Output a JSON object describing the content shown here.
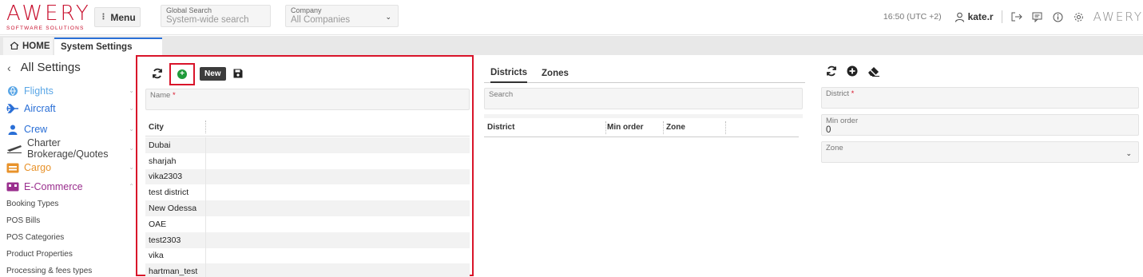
{
  "brand": {
    "name": "AWERY",
    "sub": "SOFTWARE SOLUTIONS",
    "color": "#c8102e"
  },
  "header": {
    "menu_label": "Menu",
    "global_search": {
      "label": "Global Search",
      "placeholder": "System-wide search"
    },
    "company": {
      "label": "Company",
      "value": "All Companies"
    },
    "time": "16:50 (UTC +2)",
    "user": "kate.r",
    "logo_small": "AWERY"
  },
  "tabs": {
    "home": "HOME",
    "system": "System Settings"
  },
  "sidebar": {
    "title": "All Settings",
    "items": [
      {
        "label": "Flights",
        "color": "#5aa6e6",
        "icon": "globe-icon"
      },
      {
        "label": "Aircraft",
        "color": "#2a6fd6",
        "icon": "plane-icon"
      },
      {
        "label": "Crew",
        "color": "#2a6fd6",
        "icon": "person-icon"
      },
      {
        "label": "Charter Brokerage/Quotes",
        "color": "#444444",
        "icon": "plane-takeoff-icon"
      },
      {
        "label": "Cargo",
        "color": "#e8922a",
        "icon": "cargo-icon"
      },
      {
        "label": "E-Commerce",
        "color": "#9a2f8e",
        "icon": "ecommerce-icon"
      }
    ],
    "subitems": [
      "Booking Types",
      "POS Bills",
      "POS Categories",
      "Product Properties",
      "Processing & fees types"
    ]
  },
  "left_panel": {
    "new_label": "New",
    "name_label": "Name",
    "column": "City",
    "rows": [
      "Dubai",
      "sharjah",
      "vika2303",
      "test district",
      "New Odessa",
      "OAE",
      "test2303",
      "vika",
      "hartman_test"
    ]
  },
  "mid_panel": {
    "tabs": [
      "Districts",
      "Zones"
    ],
    "search_label": "Search",
    "columns": [
      "District",
      "Min order",
      "Zone"
    ]
  },
  "right_panel": {
    "district_label": "District",
    "min_order_label": "Min order",
    "min_order_value": "0",
    "zone_label": "Zone"
  }
}
